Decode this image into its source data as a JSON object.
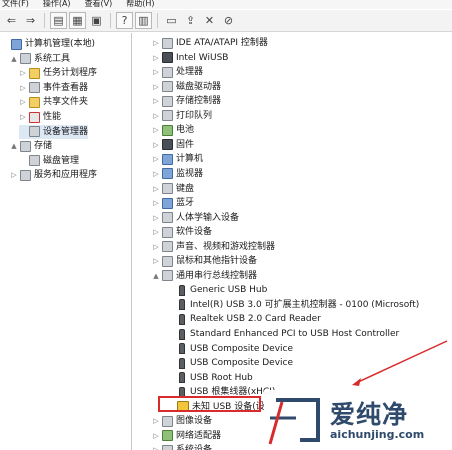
{
  "menu": [
    "文件(F)",
    "操作(A)",
    "查看(V)",
    "帮助(H)"
  ],
  "toolbar_icons": [
    "back-icon",
    "forward-icon",
    "up-folder-icon",
    "show-hide-tree-icon",
    "properties-icon",
    "help-icon",
    "action-pane-icon",
    "monitor-icon",
    "update-driver-icon",
    "disable-device-icon",
    "uninstall-icon"
  ],
  "left_tree": [
    {
      "label": "计算机管理(本地)",
      "icon": "computer-management-icon",
      "level": 0,
      "expander": ""
    },
    {
      "label": "系统工具",
      "icon": "tools-icon",
      "level": 1,
      "expander": "▲"
    },
    {
      "label": "任务计划程序",
      "icon": "clock-icon",
      "level": 2,
      "expander": "▷"
    },
    {
      "label": "事件查看器",
      "icon": "event-viewer-icon",
      "level": 2,
      "expander": "▷"
    },
    {
      "label": "共享文件夹",
      "icon": "shared-folder-icon",
      "level": 2,
      "expander": "▷"
    },
    {
      "label": "性能",
      "icon": "performance-icon",
      "level": 2,
      "expander": "▷"
    },
    {
      "label": "设备管理器",
      "icon": "device-manager-icon",
      "level": 2,
      "expander": ""
    },
    {
      "label": "存储",
      "icon": "storage-icon",
      "level": 1,
      "expander": "▲"
    },
    {
      "label": "磁盘管理",
      "icon": "disk-icon",
      "level": 2,
      "expander": ""
    },
    {
      "label": "服务和应用程序",
      "icon": "services-icon",
      "level": 1,
      "expander": "▷"
    }
  ],
  "device_tree": [
    {
      "label": "IDE ATA/ATAPI 控制器",
      "icon": "ide-icon",
      "color": "gray",
      "level": 0,
      "expander": "▷"
    },
    {
      "label": "Intel WiUSB",
      "icon": "wiusb-icon",
      "color": "dark",
      "level": 0,
      "expander": "▷"
    },
    {
      "label": "处理器",
      "icon": "processor-icon",
      "color": "gray",
      "level": 0,
      "expander": "▷"
    },
    {
      "label": "磁盘驱动器",
      "icon": "disk-drive-icon",
      "color": "gray",
      "level": 0,
      "expander": "▷"
    },
    {
      "label": "存储控制器",
      "icon": "storage-controller-icon",
      "color": "gray",
      "level": 0,
      "expander": "▷"
    },
    {
      "label": "打印队列",
      "icon": "printer-icon",
      "color": "gray",
      "level": 0,
      "expander": "▷"
    },
    {
      "label": "电池",
      "icon": "battery-icon",
      "color": "green",
      "level": 0,
      "expander": "▷"
    },
    {
      "label": "固件",
      "icon": "firmware-icon",
      "color": "dark",
      "level": 0,
      "expander": "▷"
    },
    {
      "label": "计算机",
      "icon": "computer-icon",
      "color": "blue",
      "level": 0,
      "expander": "▷"
    },
    {
      "label": "监视器",
      "icon": "monitor-icon",
      "color": "blue",
      "level": 0,
      "expander": "▷"
    },
    {
      "label": "键盘",
      "icon": "keyboard-icon",
      "color": "gray",
      "level": 0,
      "expander": "▷"
    },
    {
      "label": "蓝牙",
      "icon": "bluetooth-icon",
      "color": "blue",
      "level": 0,
      "expander": "▷"
    },
    {
      "label": "人体学输入设备",
      "icon": "hid-icon",
      "color": "gray",
      "level": 0,
      "expander": "▷"
    },
    {
      "label": "软件设备",
      "icon": "software-device-icon",
      "color": "gray",
      "level": 0,
      "expander": "▷"
    },
    {
      "label": "声音、视频和游戏控制器",
      "icon": "sound-icon",
      "color": "gray",
      "level": 0,
      "expander": "▷"
    },
    {
      "label": "鼠标和其他指针设备",
      "icon": "mouse-icon",
      "color": "gray",
      "level": 0,
      "expander": "▷"
    },
    {
      "label": "通用串行总线控制器",
      "icon": "usb-controller-icon",
      "color": "gray",
      "level": 0,
      "expander": "▲"
    },
    {
      "label": "Generic USB Hub",
      "icon": "usb-icon",
      "color": "usb",
      "level": 1,
      "expander": ""
    },
    {
      "label": "Intel(R) USB 3.0 可扩展主机控制器 - 0100 (Microsoft)",
      "icon": "usb-icon",
      "color": "usb",
      "level": 1,
      "expander": ""
    },
    {
      "label": "Realtek USB 2.0 Card Reader",
      "icon": "usb-icon",
      "color": "usb",
      "level": 1,
      "expander": ""
    },
    {
      "label": "Standard Enhanced PCI to USB Host Controller",
      "icon": "usb-icon",
      "color": "usb",
      "level": 1,
      "expander": ""
    },
    {
      "label": "USB Composite Device",
      "icon": "usb-icon",
      "color": "usb",
      "level": 1,
      "expander": ""
    },
    {
      "label": "USB Composite Device",
      "icon": "usb-icon",
      "color": "usb",
      "level": 1,
      "expander": ""
    },
    {
      "label": "USB Root Hub",
      "icon": "usb-icon",
      "color": "usb",
      "level": 1,
      "expander": ""
    },
    {
      "label": "USB 根集线器(xHCI)",
      "icon": "usb-icon",
      "color": "usb",
      "level": 1,
      "expander": ""
    },
    {
      "label": "未知 USB 设备(设",
      "icon": "warning-device-icon",
      "color": "warn",
      "level": 1,
      "expander": ""
    },
    {
      "label": "图像设备",
      "icon": "imaging-icon",
      "color": "gray",
      "level": 0,
      "expander": "▷"
    },
    {
      "label": "网络适配器",
      "icon": "network-adapter-icon",
      "color": "green",
      "level": 0,
      "expander": "▷"
    },
    {
      "label": "系统设备",
      "icon": "system-device-icon",
      "color": "gray",
      "level": 0,
      "expander": "▷"
    }
  ],
  "watermark": {
    "brand": "爱纯净",
    "url": "aichunjing.com"
  },
  "colors": {
    "highlight_box": "#d82b2b",
    "watermark": "#2f4a6b"
  }
}
